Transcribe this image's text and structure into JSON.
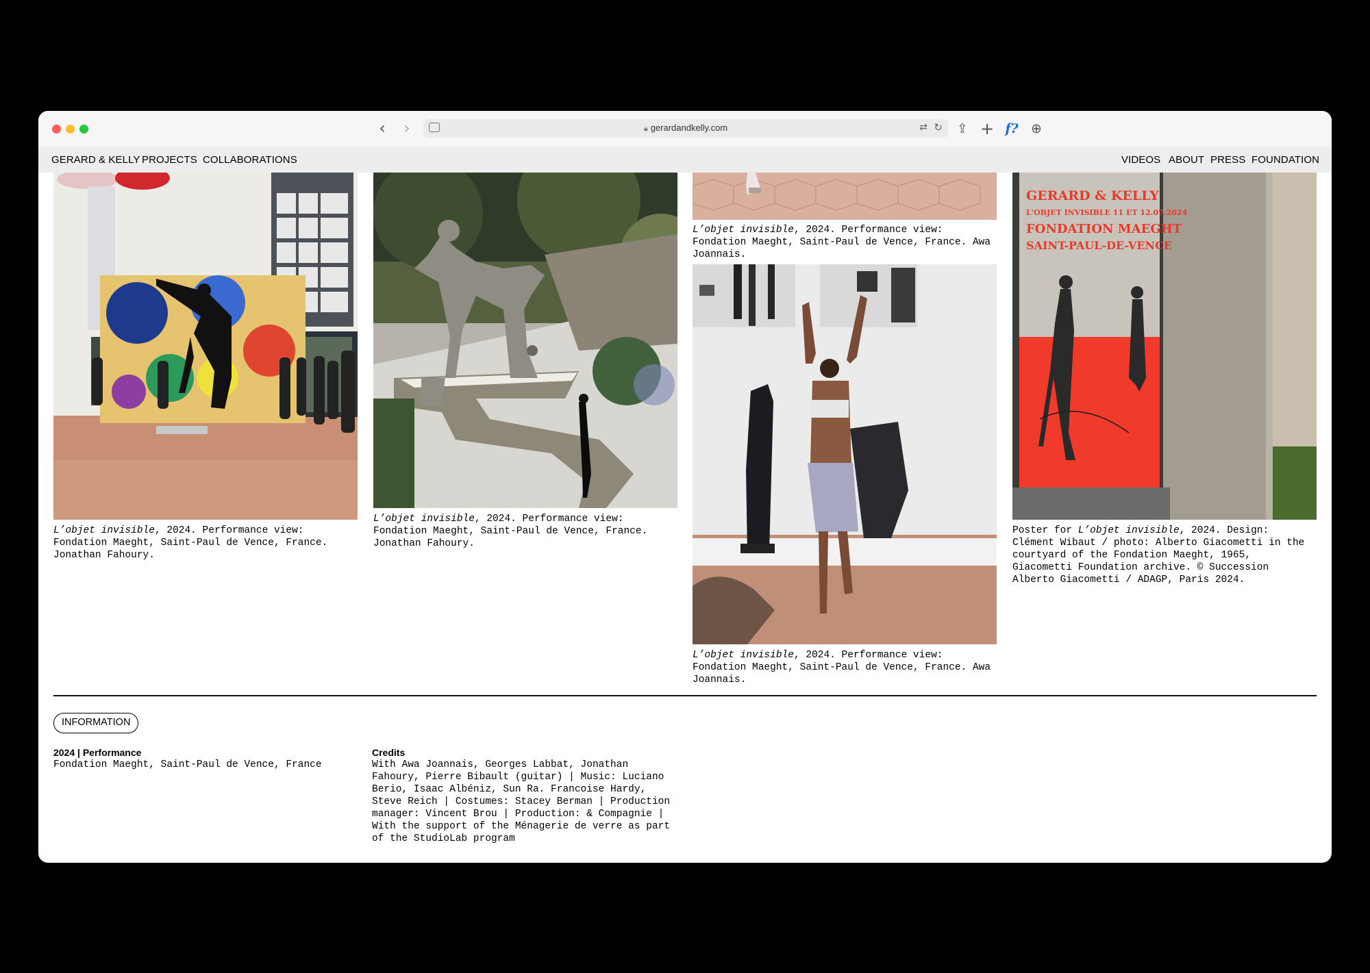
{
  "browser": {
    "url": "gerardandkelly.com"
  },
  "nav": {
    "brand": "GERARD & KELLY",
    "left": [
      "PROJECTS",
      "COLLABORATIONS"
    ],
    "right": [
      "VIDEOS",
      "ABOUT",
      "PRESS",
      "FOUNDATION"
    ]
  },
  "gallery": [
    {
      "title": "L’objet invisible",
      "rest": ", 2024. Performance view: Fondation Maeght, Saint-Paul de Vence, France. Jonathan Fahoury."
    },
    {
      "title": "L’objet invisible",
      "rest": ", 2024. Performance view: Fondation Maeght, Saint-Paul de Vence, France. Jonathan Fahoury."
    },
    {
      "title": "L’objet invisible",
      "rest": ", 2024. Performance view: Fondation Maeght, Saint-Paul de Vence, France. Awa Joannais."
    },
    {
      "title": "L’objet invisible",
      "rest": ", 2024. Performance view: Fondation Maeght, Saint-Paul de Vence, France. Awa Joannais."
    },
    {
      "prefix": "Poster for ",
      "title": "L’objet invisible",
      "rest": ", 2024. Design: Clément Wibaut / photo: Alberto Giacometti in the courtyard of the Fondation Maeght, 1965, Giacometti Foundation archive. © Succession Alberto Giacometti / ADAGP, Paris 2024."
    }
  ],
  "poster": {
    "line1": "GERARD & KELLY",
    "line2": "L'OBJET INVISIBLE 11 ET 12.07.2024",
    "line3": "FONDATION MAEGHT",
    "line4": "SAINT-PAUL-DE-VENCE"
  },
  "information": {
    "pill": "INFORMATION",
    "year_heading": "2024 | Performance",
    "location": "Fondation Maeght, Saint-Paul de Vence, France",
    "credits_heading": "Credits",
    "credits": "With Awa Joannais, Georges Labbat, Jonathan Fahoury, Pierre Bibault (guitar) | Music: Luciano Berio, Isaac Albéniz, Sun Ra. Francoise Hardy, Steve Reich | Costumes: Stacey Berman | Production manager: Vincent Brou | Production: & Compagnie | With the support of the Ménagerie de verre as part of the StudioLab program"
  },
  "colors": {
    "poster_red": "#f03a2c",
    "floor_terracotta": "#c98f74"
  }
}
